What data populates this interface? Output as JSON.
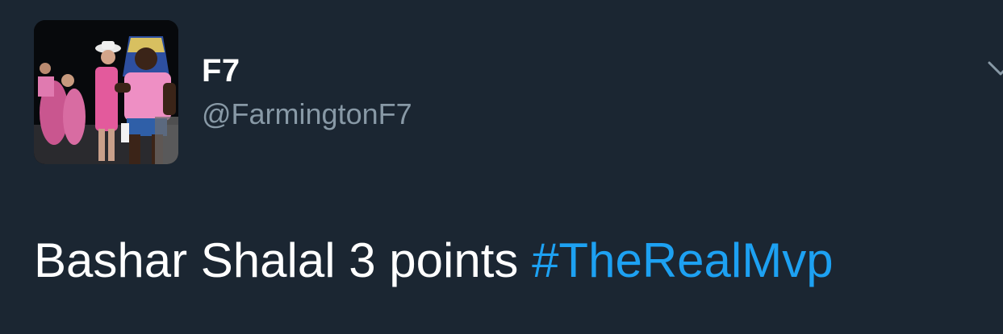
{
  "tweet": {
    "author": {
      "display_name": "F7",
      "handle": "@FarmingtonF7",
      "avatar_icon": "avatar-photo"
    },
    "menu_icon": "chevron-down-icon",
    "text": "Bashar Shalal 3 points ",
    "hashtag": "#TheRealMvp"
  },
  "colors": {
    "background": "#1b2632",
    "text": "#ffffff",
    "muted": "#8899a6",
    "link": "#1da1f2"
  }
}
